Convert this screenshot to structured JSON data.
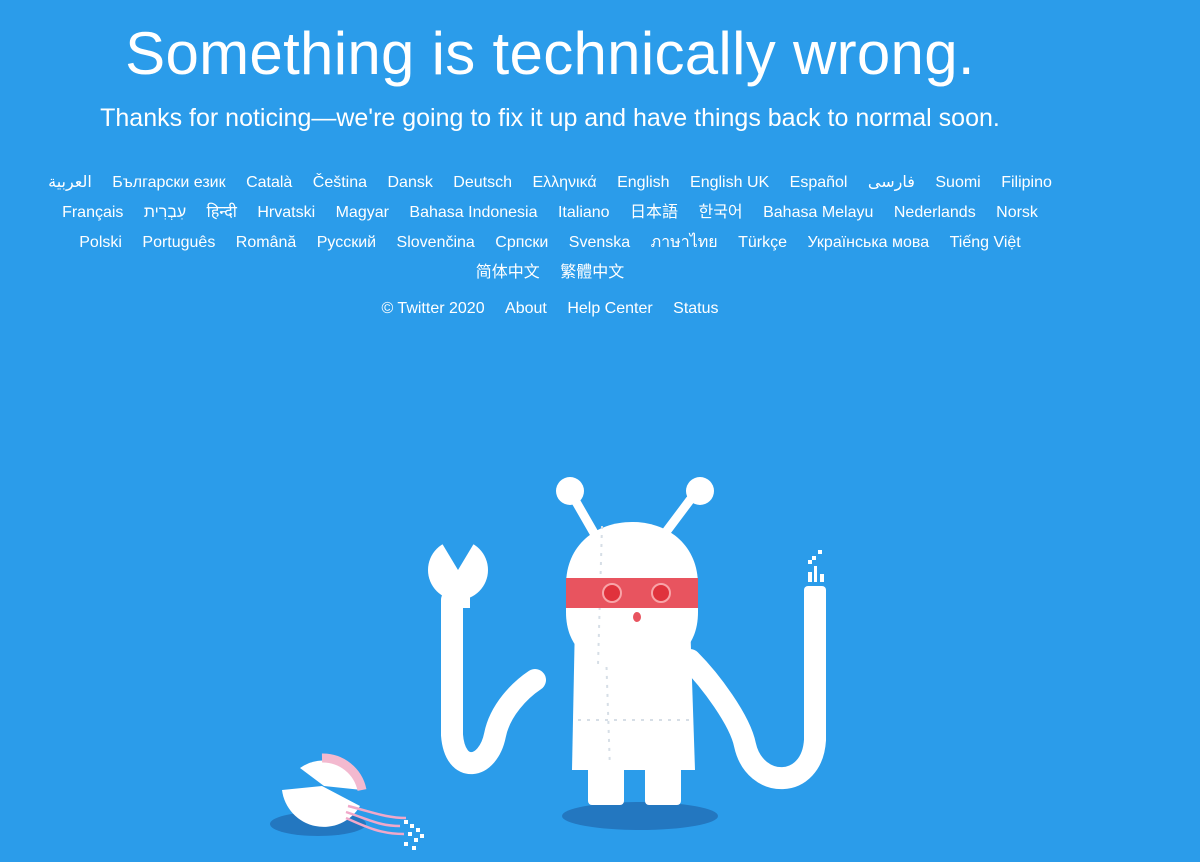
{
  "error": {
    "title": "Something is technically wrong.",
    "message": "Thanks for noticing—we're going to fix it up and have things back to normal soon."
  },
  "languages": [
    "العربية",
    "Български език",
    "Català",
    "Čeština",
    "Dansk",
    "Deutsch",
    "Ελληνικά",
    "English",
    "English UK",
    "Español",
    "فارسی",
    "Suomi",
    "Filipino",
    "Français",
    "עִבְרִית",
    "हिन्दी",
    "Hrvatski",
    "Magyar",
    "Bahasa Indonesia",
    "Italiano",
    "日本語",
    "한국어",
    "Bahasa Melayu",
    "Nederlands",
    "Norsk",
    "Polski",
    "Português",
    "Română",
    "Русский",
    "Slovenčina",
    "Српски",
    "Svenska",
    "ภาษาไทย",
    "Türkçe",
    "Українська мова",
    "Tiếng Việt",
    "简体中文",
    "繁體中文"
  ],
  "footer": {
    "copyright": "© Twitter 2020",
    "about": "About",
    "help_center": "Help Center",
    "status": "Status"
  },
  "colors": {
    "background": "#2b9cea",
    "robot_body": "#ffffff",
    "visor": "#e8545f",
    "eyes": "#e0323c",
    "shadow": "#2377c0"
  },
  "illustration": {
    "icon": "broken-robot-illustration"
  }
}
